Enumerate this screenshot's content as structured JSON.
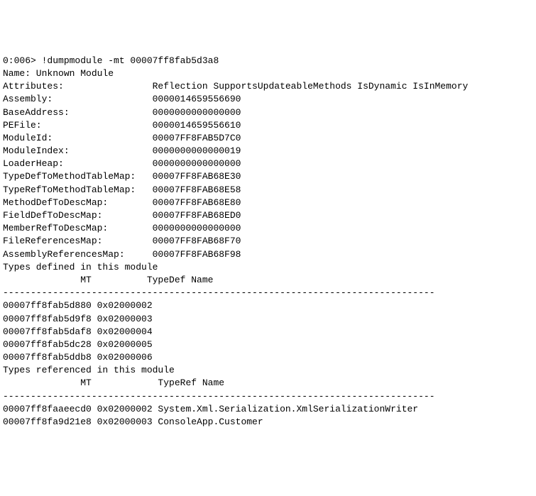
{
  "prompt": "0:006> ",
  "command": "!dumpmodule -mt 00007ff8fab5d3a8",
  "nameLabel": "Name:",
  "nameValue": " Unknown Module",
  "attrLabel": "Attributes:",
  "attrValue": "Reflection SupportsUpdateableMethods IsDynamic IsInMemory",
  "fields": [
    {
      "label": "Assembly:",
      "value": "0000014659556690"
    },
    {
      "label": "BaseAddress:",
      "value": "0000000000000000"
    },
    {
      "label": "PEFile:",
      "value": "0000014659556610"
    },
    {
      "label": "ModuleId:",
      "value": "00007FF8FAB5D7C0"
    },
    {
      "label": "ModuleIndex:",
      "value": "0000000000000019"
    },
    {
      "label": "LoaderHeap:",
      "value": "0000000000000000"
    },
    {
      "label": "TypeDefToMethodTableMap:",
      "value": "00007FF8FAB68E30"
    },
    {
      "label": "TypeRefToMethodTableMap:",
      "value": "00007FF8FAB68E58"
    },
    {
      "label": "MethodDefToDescMap:",
      "value": "00007FF8FAB68E80"
    },
    {
      "label": "FieldDefToDescMap:",
      "value": "00007FF8FAB68ED0"
    },
    {
      "label": "MemberRefToDescMap:",
      "value": "0000000000000000"
    },
    {
      "label": "FileReferencesMap:",
      "value": "00007FF8FAB68F70"
    },
    {
      "label": "AssemblyReferencesMap:",
      "value": "00007FF8FAB68F98"
    }
  ],
  "definedHeader": "Types defined in this module",
  "definedColsLine": "              MT          TypeDef Name",
  "definedSep": "------------------------------------------------------------------------------",
  "definedRows": [
    {
      "mt": "00007ff8fab5d880",
      "td": "0x02000002"
    },
    {
      "mt": "00007ff8fab5d9f8",
      "td": "0x02000003"
    },
    {
      "mt": "00007ff8fab5daf8",
      "td": "0x02000004"
    },
    {
      "mt": "00007ff8fab5dc28",
      "td": "0x02000005"
    },
    {
      "mt": "00007ff8fab5ddb8",
      "td": "0x02000006"
    }
  ],
  "refHeader": "Types referenced in this module",
  "refColsLine": "              MT            TypeRef Name",
  "refSep": "------------------------------------------------------------------------------",
  "refRows": [
    {
      "mt": "00007ff8faaeecd0",
      "tr": "0x02000002",
      "name": "System.Xml.Serialization.XmlSerializationWriter"
    },
    {
      "mt": "00007ff8fa9d21e8",
      "tr": "0x02000003",
      "name": "ConsoleApp.Customer"
    }
  ]
}
